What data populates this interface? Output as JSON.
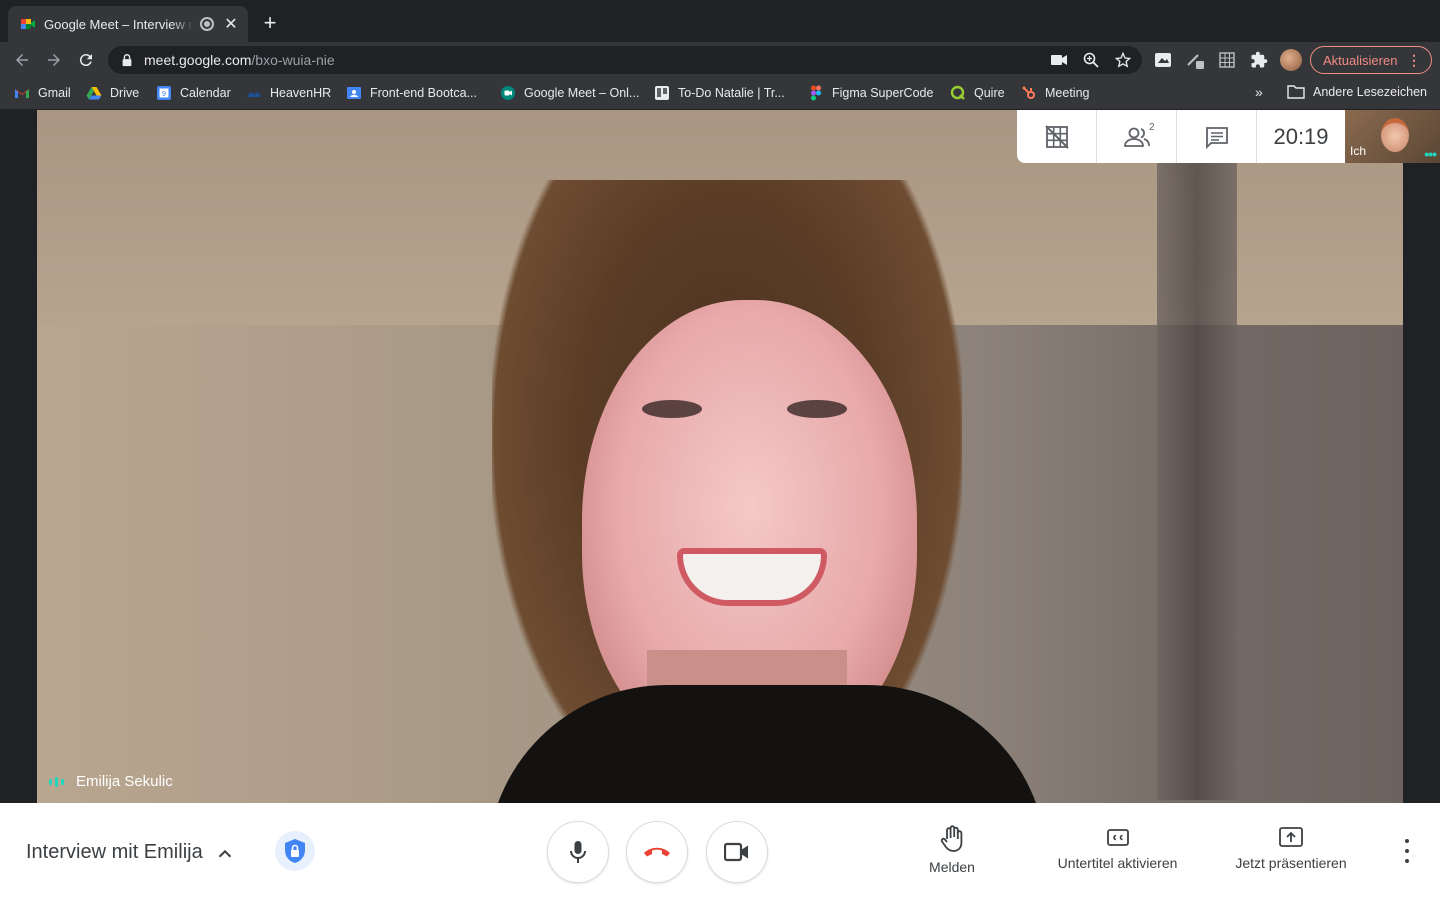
{
  "browser": {
    "tab": {
      "title": "Google Meet – Interview mit Emilija",
      "close_glyph": "✕"
    },
    "new_tab_glyph": "+",
    "url": {
      "host": "meet.google.com",
      "path": "/bxo-wuia-nie"
    },
    "update_button": "Aktualisieren",
    "update_menu_glyph": "⋮",
    "bookmarks": [
      {
        "label": "Gmail",
        "icon": "gmail-icon"
      },
      {
        "label": "Drive",
        "icon": "drive-icon"
      },
      {
        "label": "Calendar",
        "icon": "calendar-icon"
      },
      {
        "label": "HeavenHR",
        "icon": "heavenhr-icon"
      },
      {
        "label": "Front-end Bootca...",
        "icon": "classroom-icon"
      },
      {
        "label": "Google Meet – Onl...",
        "icon": "meet-icon"
      },
      {
        "label": "To-Do Natalie | Tr...",
        "icon": "trello-icon"
      },
      {
        "label": "Figma SuperCode",
        "icon": "figma-icon"
      },
      {
        "label": "Quire",
        "icon": "quire-icon"
      },
      {
        "label": "Meeting",
        "icon": "hubspot-icon"
      }
    ],
    "bookmarks_overflow": "»",
    "other_bookmarks": "Andere Lesezeichen"
  },
  "meet": {
    "participant_name": "Emilija Sekulic",
    "participant_count": "2",
    "clock": "20:19",
    "self_label": "Ich",
    "self_more": "•••",
    "meeting_title": "Interview mit Emilija",
    "actions": {
      "raise_hand": "Melden",
      "captions": "Untertitel aktivieren",
      "present": "Jetzt präsentieren"
    }
  },
  "colors": {
    "accent_red": "#ea4335",
    "speaking_teal": "#1ed6bd",
    "update_outline": "#f28b82"
  }
}
